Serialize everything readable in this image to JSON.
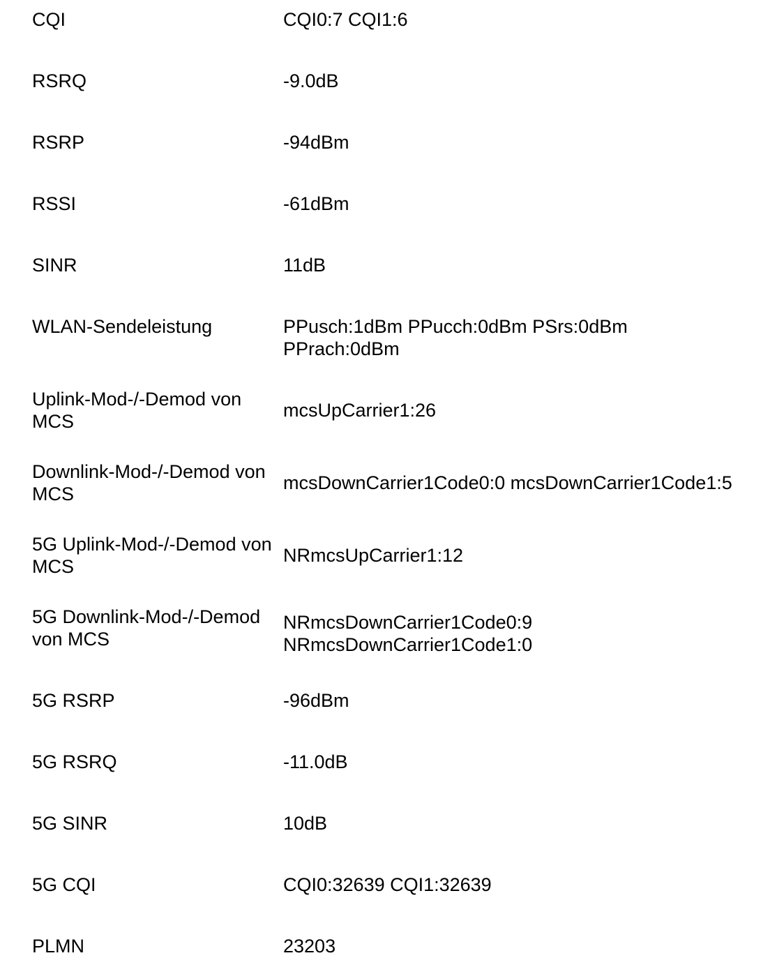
{
  "rows": [
    {
      "label": "CQI",
      "value": [
        "CQI0:7 CQI1:6"
      ]
    },
    {
      "label": "RSRQ",
      "value": [
        "-9.0dB"
      ]
    },
    {
      "label": "RSRP",
      "value": [
        "-94dBm"
      ]
    },
    {
      "label": "RSSI",
      "value": [
        "-61dBm"
      ]
    },
    {
      "label": "SINR",
      "value": [
        "11dB"
      ]
    },
    {
      "label": "WLAN-Sendeleistung",
      "value": [
        "PPusch:1dBm PPucch:0dBm PSrs:0dBm",
        "PPrach:0dBm"
      ]
    },
    {
      "label": "Uplink-Mod-/-Demod von MCS",
      "value": [
        "mcsUpCarrier1:26"
      ]
    },
    {
      "label": "Downlink-Mod-/-Demod von MCS",
      "value": [
        "mcsDownCarrier1Code0:0 mcsDownCarrier1Code1:5"
      ]
    },
    {
      "label": "5G Uplink-Mod-/-Demod von MCS",
      "value": [
        "NRmcsUpCarrier1:12"
      ]
    },
    {
      "label": "5G Downlink-Mod-/-Demod von MCS",
      "value": [
        "NRmcsDownCarrier1Code0:9",
        "NRmcsDownCarrier1Code1:0"
      ]
    },
    {
      "label": "5G RSRP",
      "value": [
        "-96dBm"
      ]
    },
    {
      "label": "5G RSRQ",
      "value": [
        "-11.0dB"
      ]
    },
    {
      "label": "5G SINR",
      "value": [
        "10dB"
      ]
    },
    {
      "label": "5G CQI",
      "value": [
        "CQI0:32639 CQI1:32639"
      ]
    },
    {
      "label": "PLMN",
      "value": [
        "23203"
      ]
    }
  ]
}
